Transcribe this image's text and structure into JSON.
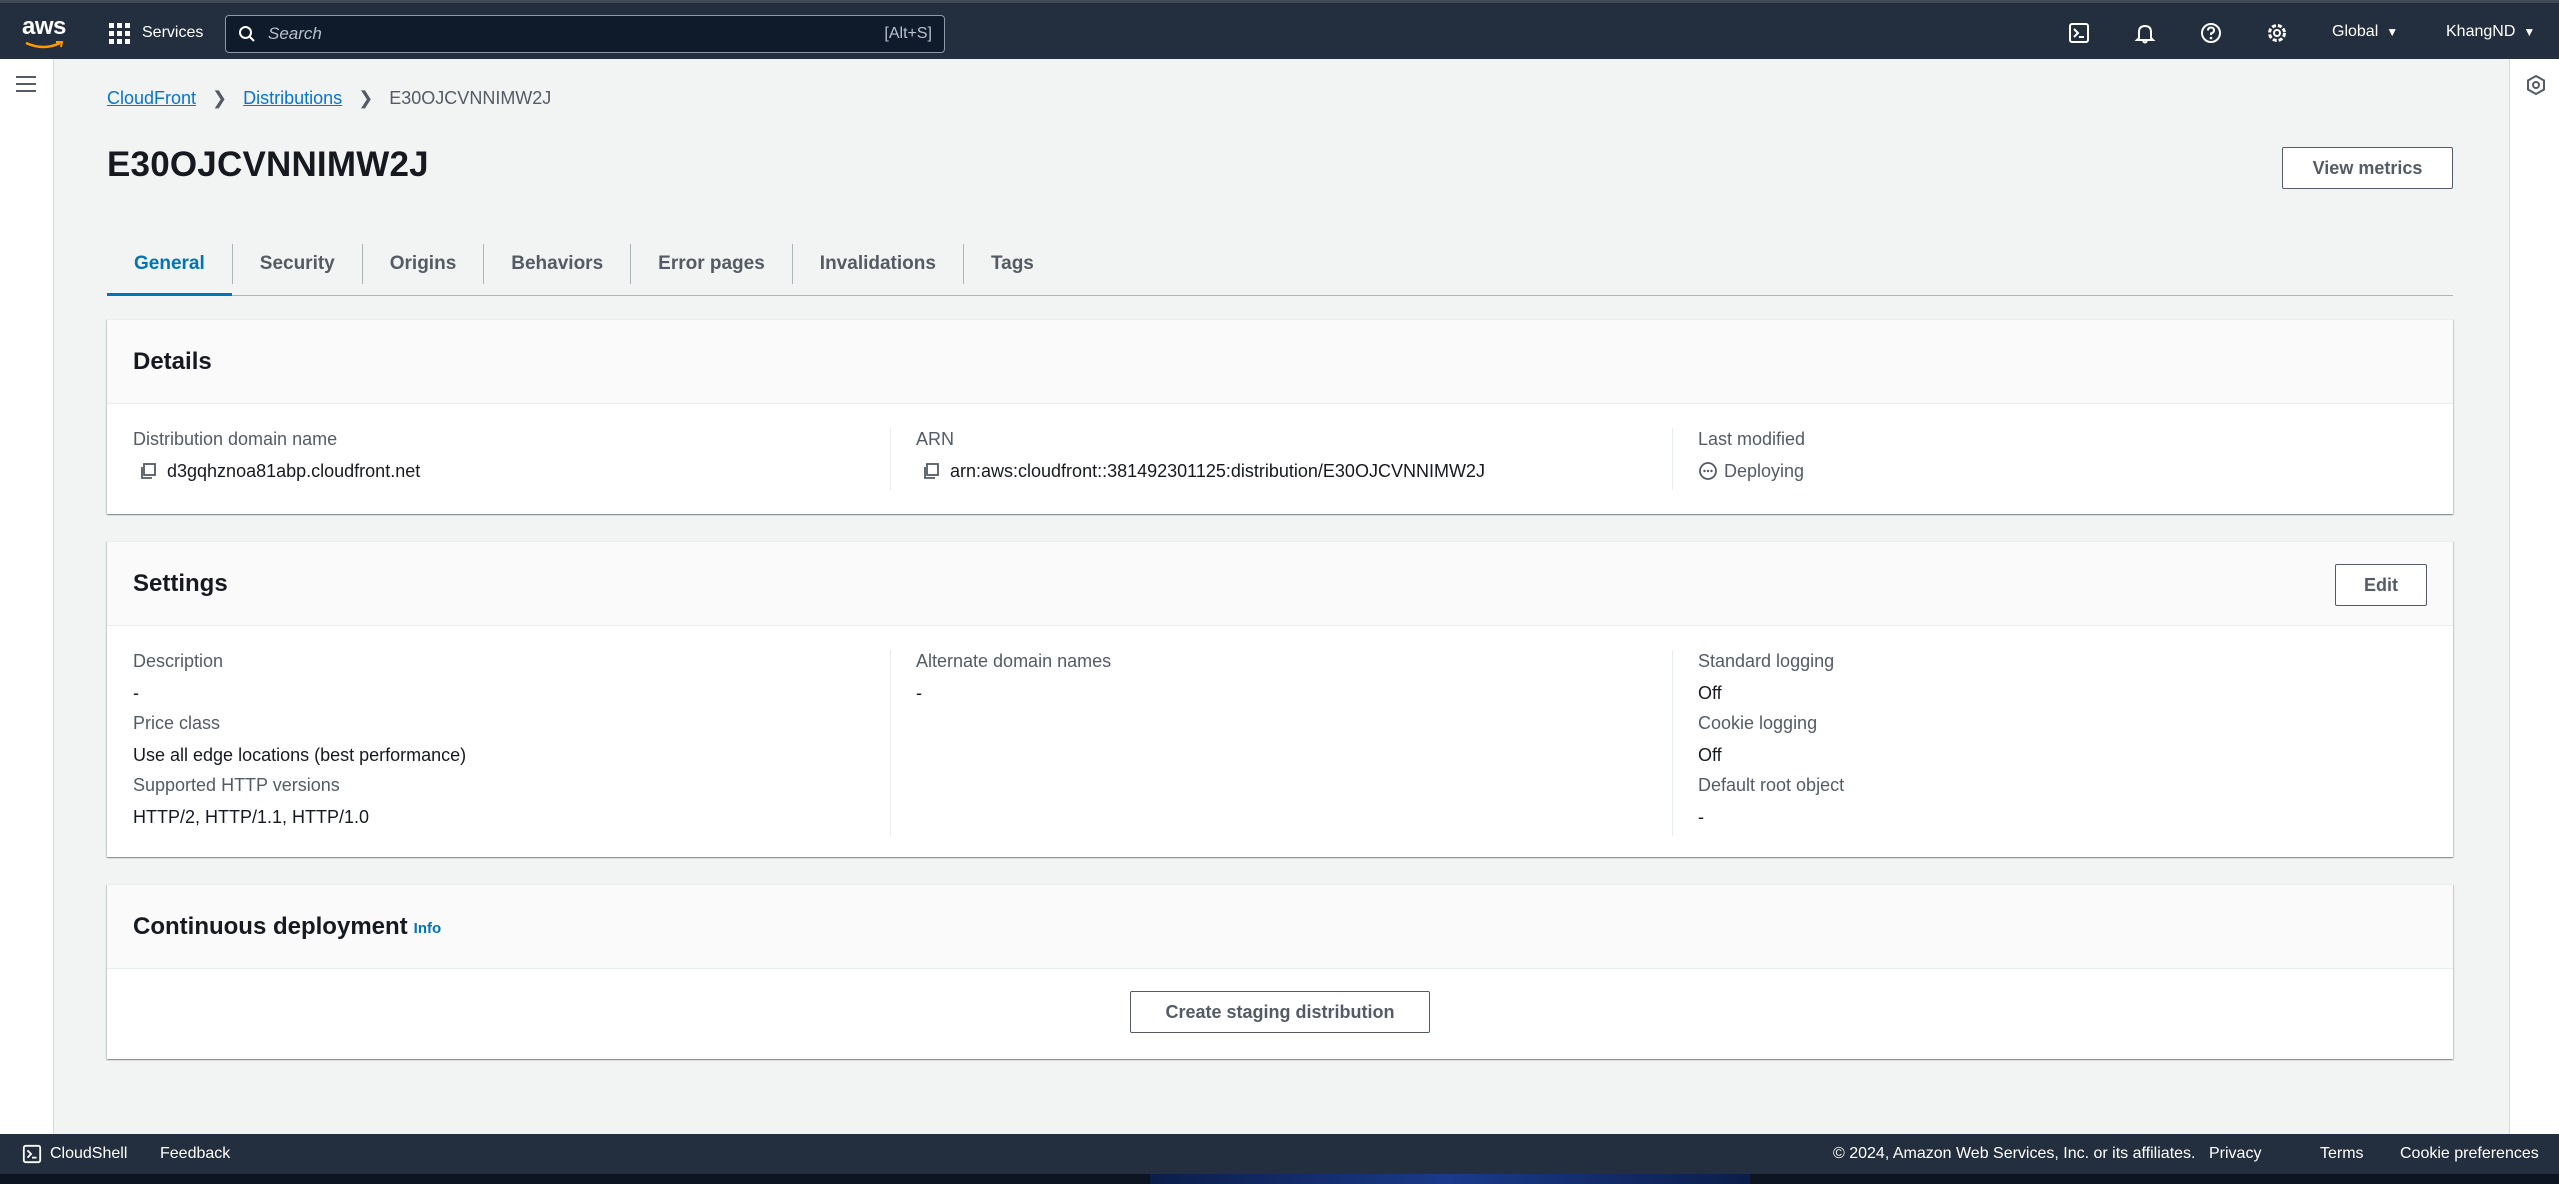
{
  "topnav": {
    "logo_text": "aws",
    "services_label": "Services",
    "search_placeholder": "Search",
    "search_shortcut": "[Alt+S]",
    "icons": [
      "cloudshell-icon",
      "bell-icon",
      "help-icon",
      "gear-icon"
    ],
    "region_label": "Global",
    "account_label": "KhangND"
  },
  "breadcrumb": {
    "items": [
      "CloudFront",
      "Distributions"
    ],
    "current": "E30OJCVNNIMW2J"
  },
  "page": {
    "title": "E30OJCVNNIMW2J",
    "view_metrics_label": "View metrics"
  },
  "tabs": [
    "General",
    "Security",
    "Origins",
    "Behaviors",
    "Error pages",
    "Invalidations",
    "Tags"
  ],
  "active_tab": "General",
  "details": {
    "title": "Details",
    "domain_label": "Distribution domain name",
    "domain_value": "d3gqhznoa81abp.cloudfront.net",
    "arn_label": "ARN",
    "arn_value": "arn:aws:cloudfront::381492301125:distribution/E30OJCVNNIMW2J",
    "modified_label": "Last modified",
    "modified_value": "Deploying"
  },
  "settings": {
    "title": "Settings",
    "edit_label": "Edit",
    "description_label": "Description",
    "description_value": "-",
    "price_label": "Price class",
    "price_value": "Use all edge locations (best performance)",
    "http_label": "Supported HTTP versions",
    "http_value": "HTTP/2, HTTP/1.1, HTTP/1.0",
    "alt_domains_label": "Alternate domain names",
    "alt_domains_value": "-",
    "std_logging_label": "Standard logging",
    "std_logging_value": "Off",
    "cookie_logging_label": "Cookie logging",
    "cookie_logging_value": "Off",
    "root_object_label": "Default root object",
    "root_object_value": "-"
  },
  "continuous": {
    "title": "Continuous deployment",
    "info_label": "Info",
    "create_label": "Create staging distribution"
  },
  "footer": {
    "cloudshell_label": "CloudShell",
    "feedback_label": "Feedback",
    "copyright": "© 2024, Amazon Web Services, Inc. or its affiliates.",
    "privacy": "Privacy",
    "terms": "Terms",
    "cookie_prefs": "Cookie preferences"
  },
  "colors": {
    "nav_bg": "#232f3e",
    "link": "#0972d3",
    "tab_active": "#0073bb",
    "page_bg": "#f2f3f3"
  }
}
